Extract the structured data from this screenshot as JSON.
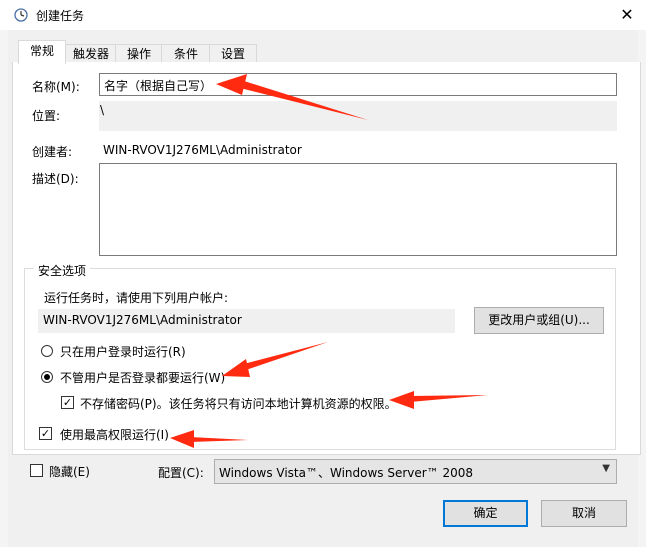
{
  "window": {
    "title": "创建任务",
    "close_symbol": "✕"
  },
  "tabs": [
    {
      "label": "常规"
    },
    {
      "label": "触发器"
    },
    {
      "label": "操作"
    },
    {
      "label": "条件"
    },
    {
      "label": "设置"
    }
  ],
  "general": {
    "name_label": "名称(M):",
    "name_value": "名字（根据自己写）",
    "location_label": "位置:",
    "location_value": "\\",
    "author_label": "创建者:",
    "author_value": "WIN-RVOV1J276ML\\Administrator",
    "description_label": "描述(D):",
    "description_value": ""
  },
  "security": {
    "legend": "安全选项",
    "run_as_label": "运行任务时，请使用下列用户帐户:",
    "user_account": "WIN-RVOV1J276ML\\Administrator",
    "change_user_button": "更改用户或组(U)...",
    "radio_logged_on": "只在用户登录时运行(R)",
    "radio_logged_on_selected": false,
    "radio_whether_logged": "不管用户是否登录都要运行(W)",
    "radio_whether_logged_selected": true,
    "no_store_password": "不存储密码(P)。该任务将只有访问本地计算机资源的权限。",
    "no_store_password_checked": true,
    "highest_privileges": "使用最高权限运行(I)",
    "highest_privileges_checked": true
  },
  "footer": {
    "hidden_label": "隐藏(E)",
    "hidden_checked": false,
    "config_label": "配置(C):",
    "config_value": "Windows Vista™、Windows Server™ 2008",
    "ok_button": "确定",
    "cancel_button": "取消"
  },
  "annotations": {
    "arrow_color": "#ff2a10"
  }
}
